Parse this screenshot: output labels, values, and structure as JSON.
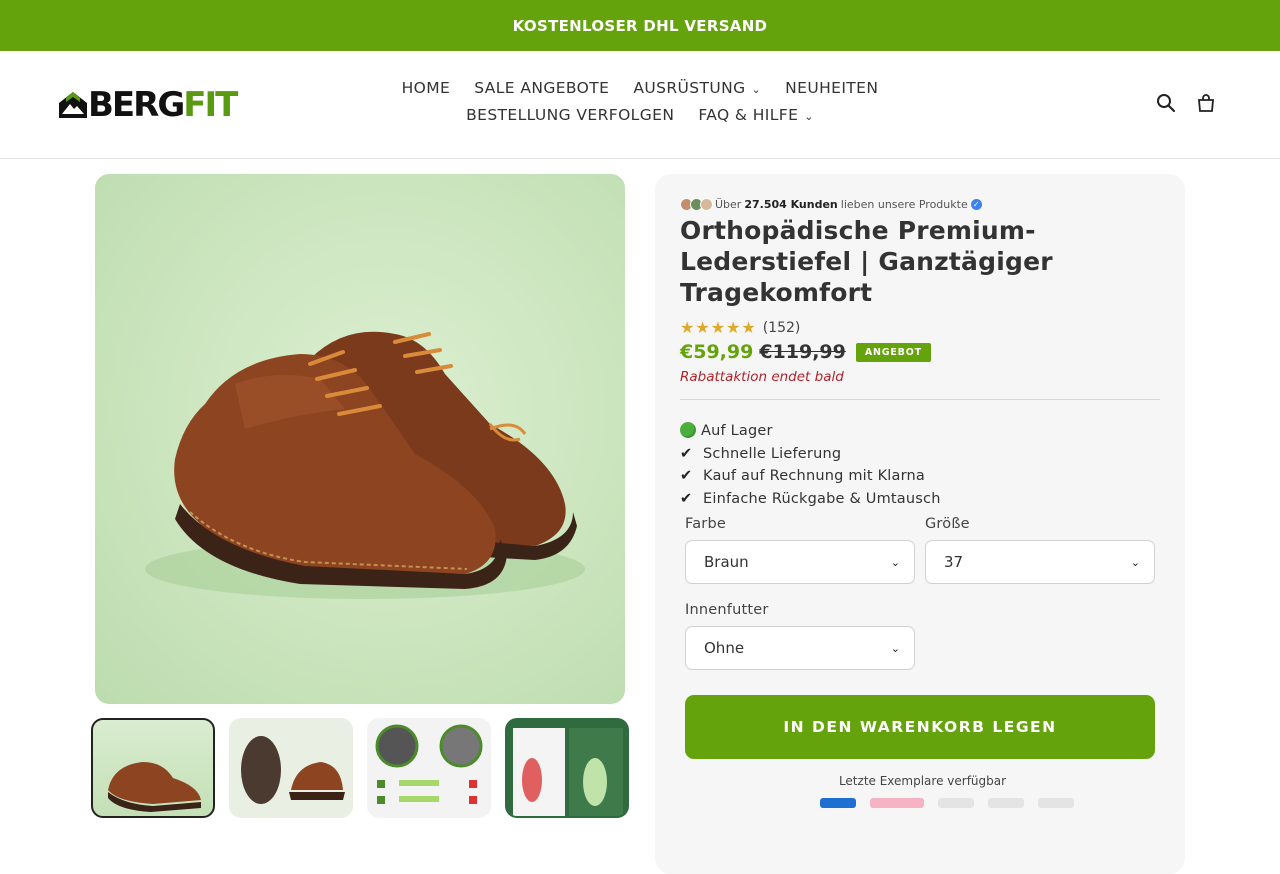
{
  "announcement": "KOSTENLOSER DHL VERSAND",
  "header": {
    "logo_part1": "BERG",
    "logo_part2": "FIT",
    "nav": [
      {
        "label": "HOME",
        "dropdown": false
      },
      {
        "label": "SALE ANGEBOTE",
        "dropdown": false
      },
      {
        "label": "AUSRÜSTUNG",
        "dropdown": true
      },
      {
        "label": "NEUHEITEN",
        "dropdown": false
      },
      {
        "label": "BESTELLUNG VERFOLGEN",
        "dropdown": false
      },
      {
        "label": "FAQ & HILFE",
        "dropdown": true
      }
    ],
    "icons": [
      "search-icon",
      "cart-icon"
    ]
  },
  "product": {
    "social_prefix": "Über",
    "social_count": "27.504 Kunden",
    "social_suffix": "lieben unsere Produkte",
    "title": "Orthopädische Premium-Lederstiefel | Ganztägiger Tragekomfort",
    "stars": "★★★★★",
    "rating_count": "(152)",
    "price": "€59,99",
    "compare_price": "€119,99",
    "badge": "ANGEBOT",
    "urgency": "Rabattaktion endet bald",
    "features": [
      "Auf Lager",
      "Schnelle Lieferung",
      "Kauf auf Rechnung mit Klarna",
      "Einfache Rückgabe & Umtausch"
    ],
    "options": {
      "color_label": "Farbe",
      "color_value": "Braun",
      "size_label": "Größe",
      "size_value": "37",
      "lining_label": "Innenfutter",
      "lining_value": "Ohne"
    },
    "cart_button": "IN DEN WARENKORB LEGEN",
    "stock_note": "Letzte Exemplare verfügbar"
  },
  "colors": {
    "brand_green": "#65a30d",
    "urgency_red": "#b4232a",
    "star_gold": "#e0a928"
  }
}
